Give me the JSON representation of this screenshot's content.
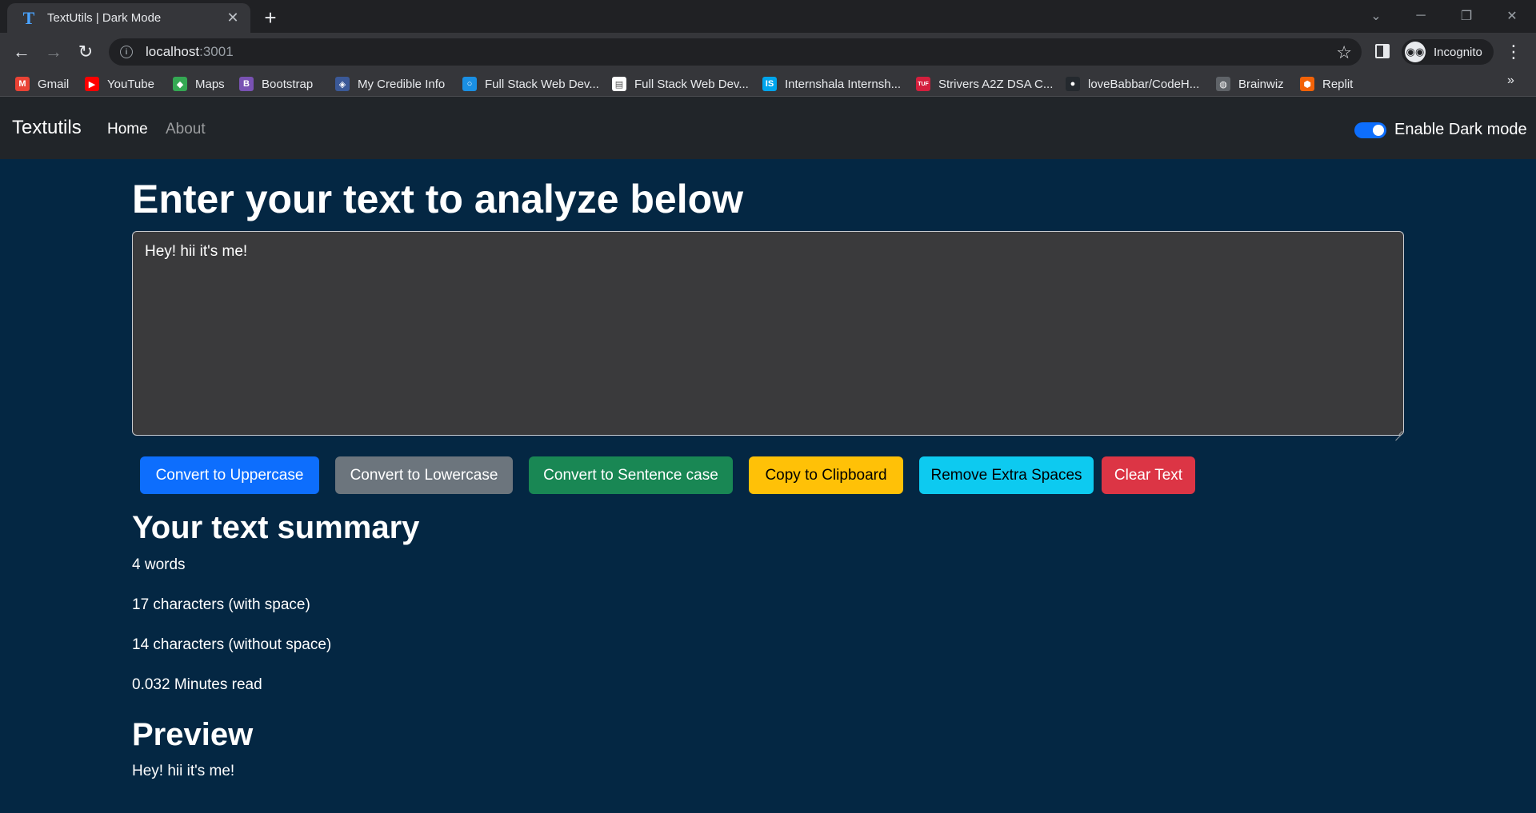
{
  "browser": {
    "tab": {
      "title": "TextUtils | Dark Mode",
      "favicon": "T"
    },
    "url": {
      "host": "localhost",
      "port": ":3001"
    },
    "profile_label": "Incognito",
    "bookmarks": [
      {
        "label": "Gmail",
        "icon": "gmail-icon",
        "color": "#ea4335",
        "glyph": "M"
      },
      {
        "label": "YouTube",
        "icon": "youtube-icon",
        "color": "#ff0000",
        "glyph": "▶"
      },
      {
        "label": "Maps",
        "icon": "maps-icon",
        "color": "#34a853",
        "glyph": "◆"
      },
      {
        "label": "Bootstrap",
        "icon": "bootstrap-icon",
        "color": "#7952b3",
        "glyph": "B"
      },
      {
        "label": "My Credible Info",
        "icon": "credible-icon",
        "color": "#3b5998",
        "glyph": "◈"
      },
      {
        "label": "Full Stack Web Dev...",
        "icon": "globe-blue-icon",
        "color": "#1a8fe3",
        "glyph": "○"
      },
      {
        "label": "Full Stack Web Dev...",
        "icon": "page-icon",
        "color": "#ffffff",
        "glyph": "▤"
      },
      {
        "label": "Internshala Internsh...",
        "icon": "internshala-icon",
        "color": "#00a5ec",
        "glyph": "IS"
      },
      {
        "label": "Strivers A2Z DSA C...",
        "icon": "tuf-icon",
        "color": "#d41f3d",
        "glyph": "TUF"
      },
      {
        "label": "loveBabbar/CodeH...",
        "icon": "github-icon",
        "color": "#24292e",
        "glyph": "●"
      },
      {
        "label": "Brainwiz",
        "icon": "globe-icon",
        "color": "#5f6368",
        "glyph": "◍"
      },
      {
        "label": "Replit",
        "icon": "replit-icon",
        "color": "#f26207",
        "glyph": "⬢"
      }
    ],
    "more_bookmarks": "»"
  },
  "navbar": {
    "brand": "Textutils",
    "links": {
      "home": "Home",
      "about": "About"
    },
    "dark_mode_label": "Enable Dark mode",
    "dark_mode_on": true
  },
  "main": {
    "heading": "Enter your text to analyze below",
    "text_value": "Hey! hii it's me!",
    "buttons": {
      "uppercase": "Convert to Uppercase",
      "lowercase": "Convert to Lowercase",
      "sentence": "Convert to Sentence case",
      "copy": "Copy to Clipboard",
      "spaces": "Remove Extra Spaces",
      "clear": "Clear Text"
    },
    "summary_title": "Your text summary",
    "stats": {
      "words": "4 words",
      "chars_with_space": "17 characters (with space)",
      "chars_without_space": "14 characters (without space)",
      "read_time": "0.032 Minutes read"
    },
    "preview_title": "Preview",
    "preview_text": "Hey! hii it's me!"
  },
  "colors": {
    "page_bg": "#042743",
    "navbar_bg": "#212529",
    "primary": "#0d6efd",
    "secondary": "#6c757d",
    "success": "#198754",
    "warning": "#ffc107",
    "info": "#0dcaf0",
    "danger": "#dc3545"
  }
}
